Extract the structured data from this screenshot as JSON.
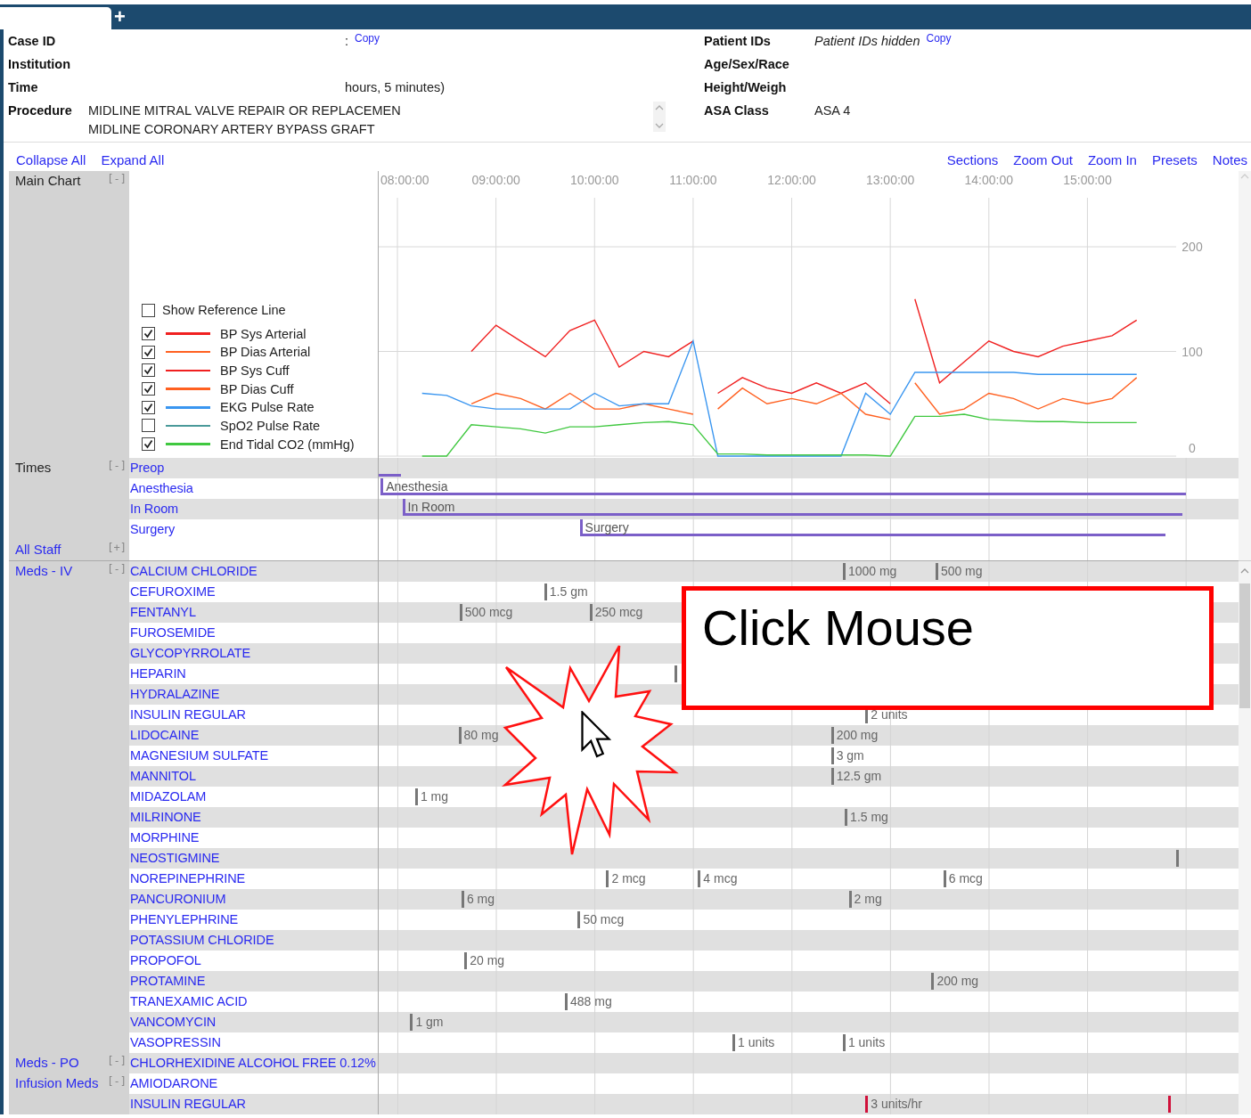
{
  "window": {
    "new_tab_button": "+"
  },
  "header": {
    "left": [
      {
        "label": "Case ID",
        "masked": true,
        "value": ":",
        "copy": "Copy"
      },
      {
        "label": "Institution"
      },
      {
        "label": "Time",
        "masked": true,
        "value": "hours, 5 minutes)"
      },
      {
        "label": "Procedure",
        "lines": [
          "MIDLINE MITRAL VALVE REPAIR OR REPLACEMEN",
          "MIDLINE CORONARY ARTERY BYPASS GRAFT"
        ]
      }
    ],
    "right": [
      {
        "label": "Patient IDs",
        "hidden": true,
        "value": "Patient IDs hidden",
        "copy": "Copy"
      },
      {
        "label": "Age/Sex/Race"
      },
      {
        "label": "Height/Weigh"
      },
      {
        "label": "ASA Class",
        "value": "ASA 4"
      }
    ]
  },
  "toolbar": {
    "left": [
      "Collapse All",
      "Expand All"
    ],
    "right": [
      "Sections",
      "Zoom Out",
      "Zoom In",
      "Presets",
      "Notes"
    ]
  },
  "sections": [
    {
      "kind": "chart",
      "name": "Main Chart",
      "toggle": "[-]",
      "reference_line": {
        "label": "Show Reference Line",
        "checked": false
      },
      "legend": [
        {
          "checked": true
        },
        {
          "checked": true
        },
        {
          "checked": true
        },
        {
          "checked": true
        },
        {
          "checked": true
        },
        {
          "checked": false
        },
        {
          "checked": true
        }
      ],
      "chart_data": {
        "type": "line",
        "grid": true,
        "x": [
          8.25,
          8.5,
          8.75,
          9,
          9.25,
          9.5,
          9.75,
          10,
          10.25,
          10.5,
          10.75,
          11,
          11.25,
          11.5,
          11.75,
          12,
          12.25,
          12.5,
          12.75,
          13,
          13.25,
          13.5,
          13.75,
          14,
          14.25,
          14.5,
          14.75,
          15,
          15.25,
          15.5
        ],
        "series": [
          {
            "name": "BP Sys Arterial",
            "color": "#f02020",
            "values": [
              null,
              null,
              100,
              125,
              110,
              95,
              120,
              130,
              85,
              100,
              95,
              110,
              null,
              null,
              null,
              null,
              null,
              null,
              null,
              null,
              150,
              70,
              90,
              110,
              100,
              95,
              105,
              110,
              115,
              130
            ]
          },
          {
            "name": "BP Dias Arterial",
            "color": "#ff6020",
            "values": [
              null,
              null,
              50,
              60,
              55,
              45,
              60,
              45,
              45,
              50,
              45,
              40,
              null,
              null,
              null,
              null,
              null,
              null,
              null,
              null,
              70,
              40,
              45,
              60,
              55,
              45,
              55,
              50,
              55,
              75
            ]
          },
          {
            "name": "BP Sys Cuff",
            "color": "#f02020",
            "values": [
              null,
              null,
              null,
              null,
              null,
              null,
              null,
              null,
              null,
              null,
              null,
              null,
              60,
              75,
              65,
              60,
              70,
              60,
              70,
              50,
              null,
              null,
              null,
              null,
              null,
              null,
              null,
              null,
              null,
              null
            ]
          },
          {
            "name": "BP Dias Cuff",
            "color": "#ff6020",
            "values": [
              null,
              null,
              null,
              null,
              null,
              null,
              null,
              null,
              null,
              null,
              null,
              null,
              45,
              65,
              50,
              55,
              50,
              60,
              40,
              35,
              null,
              null,
              null,
              null,
              null,
              null,
              null,
              null,
              null,
              null
            ]
          },
          {
            "name": "EKG Pulse Rate",
            "color": "#3a96f0",
            "values": [
              60,
              58,
              48,
              45,
              45,
              45,
              45,
              60,
              48,
              50,
              50,
              110,
              0,
              0,
              0,
              0,
              0,
              0,
              60,
              40,
              80,
              80,
              80,
              80,
              80,
              78,
              78,
              78,
              78,
              78
            ]
          },
          {
            "name": "SpO2 Pulse Rate",
            "color": "#4a9a9a",
            "values": [
              null,
              null,
              null,
              null,
              null,
              null,
              null,
              null,
              null,
              null,
              null,
              null,
              null,
              null,
              null,
              null,
              null,
              null,
              null,
              null,
              null,
              null,
              null,
              null,
              null,
              null,
              null,
              null,
              null,
              null
            ]
          },
          {
            "name": "End Tidal CO2 (mmHg)",
            "color": "#40c840",
            "values": [
              0,
              0,
              30,
              28,
              26,
              22,
              28,
              28,
              30,
              32,
              33,
              30,
              2,
              2,
              1,
              1,
              1,
              1,
              1,
              0,
              38,
              38,
              40,
              35,
              34,
              33,
              33,
              32,
              32,
              32
            ]
          }
        ],
        "xticks": [
          {
            "value": 8,
            "label": "08:00:00"
          },
          {
            "value": 9,
            "label": "09:00:00"
          },
          {
            "value": 10,
            "label": "10:00:00"
          },
          {
            "value": 11,
            "label": "11:00:00"
          },
          {
            "value": 12,
            "label": "12:00:00"
          },
          {
            "value": 13,
            "label": "13:00:00"
          },
          {
            "value": 14,
            "label": "14:00:00"
          },
          {
            "value": 15,
            "label": "15:00:00"
          }
        ],
        "yticks": [
          0,
          100,
          200
        ],
        "xlim": [
          7.81,
          15.9
        ],
        "ylim": [
          0,
          200
        ]
      }
    },
    {
      "kind": "times",
      "name": "Times",
      "toggle": "[-]",
      "rows": [
        {
          "name": "Preop"
        },
        {
          "name": "Anesthesia",
          "bar_label": "Anesthesia"
        },
        {
          "name": "In Room",
          "bar_label": "In Room"
        },
        {
          "name": "Surgery",
          "bar_label": "Surgery"
        }
      ]
    },
    {
      "kind": "staff",
      "name": "All Staff",
      "toggle": "[+]"
    },
    {
      "kind": "meds",
      "name": "Meds - IV",
      "toggle": "[-]",
      "rows": [
        {
          "name": "CALCIUM CHLORIDE",
          "doses": [
            {
              "kind": "bolus",
              "text": "1000 mg"
            },
            {
              "kind": "bolus",
              "text": "500 mg"
            }
          ]
        },
        {
          "name": "CEFUROXIME",
          "doses": [
            {
              "kind": "bolus",
              "text": "1.5 gm"
            }
          ]
        },
        {
          "name": "FENTANYL",
          "doses": [
            {
              "kind": "bolus",
              "text": "500 mcg"
            },
            {
              "kind": "bolus",
              "text": "250 mcg"
            }
          ]
        },
        {
          "name": "FUROSEMIDE"
        },
        {
          "name": "GLYCOPYRROLATE"
        },
        {
          "name": "HEPARIN",
          "doses": [
            {
              "kind": "bolus"
            }
          ]
        },
        {
          "name": "HYDRALAZINE"
        },
        {
          "name": "INSULIN REGULAR",
          "doses": [
            {
              "kind": "bolus",
              "text": "2 units"
            }
          ]
        },
        {
          "name": "LIDOCAINE",
          "doses": [
            {
              "kind": "bolus",
              "text": "80 mg"
            },
            {
              "kind": "bolus",
              "text": "200 mg"
            }
          ]
        },
        {
          "name": "MAGNESIUM SULFATE",
          "doses": [
            {
              "kind": "bolus",
              "text": "3 gm"
            }
          ]
        },
        {
          "name": "MANNITOL",
          "doses": [
            {
              "kind": "bolus",
              "text": "12.5 gm"
            }
          ]
        },
        {
          "name": "MIDAZOLAM",
          "doses": [
            {
              "kind": "bolus",
              "text": "1 mg"
            }
          ]
        },
        {
          "name": "MILRINONE",
          "doses": [
            {
              "kind": "bolus",
              "text": "1.5 mg"
            }
          ]
        },
        {
          "name": "MORPHINE"
        },
        {
          "name": "NEOSTIGMINE",
          "doses": [
            {
              "kind": "bolus"
            }
          ]
        },
        {
          "name": "NOREPINEPHRINE",
          "doses": [
            {
              "kind": "bolus",
              "text": "2 mcg"
            },
            {
              "kind": "bolus",
              "text": "4 mcg"
            },
            {
              "kind": "bolus",
              "text": "6 mcg"
            }
          ]
        },
        {
          "name": "PANCURONIUM",
          "doses": [
            {
              "kind": "bolus",
              "text": "6 mg"
            },
            {
              "kind": "bolus",
              "text": "2 mg"
            }
          ]
        },
        {
          "name": "PHENYLEPHRINE",
          "doses": [
            {
              "kind": "bolus",
              "text": "50 mcg"
            }
          ]
        },
        {
          "name": "POTASSIUM CHLORIDE"
        },
        {
          "name": "PROPOFOL",
          "doses": [
            {
              "kind": "bolus",
              "text": "20 mg"
            }
          ]
        },
        {
          "name": "PROTAMINE",
          "doses": [
            {
              "kind": "bolus",
              "text": "200 mg"
            }
          ]
        },
        {
          "name": "TRANEXAMIC ACID",
          "doses": [
            {
              "kind": "bolus",
              "text": "488 mg"
            }
          ]
        },
        {
          "name": "VANCOMYCIN",
          "doses": [
            {
              "kind": "bolus",
              "text": "1 gm"
            }
          ]
        },
        {
          "name": "VASOPRESSIN",
          "doses": [
            {
              "kind": "bolus",
              "text": "1 units"
            },
            {
              "kind": "bolus",
              "text": "1 units"
            }
          ]
        }
      ]
    },
    {
      "kind": "meds",
      "name": "Meds - PO",
      "toggle": "[-]",
      "rows": [
        {
          "name": "CHLORHEXIDINE ALCOHOL FREE 0.12%"
        }
      ]
    },
    {
      "kind": "meds",
      "name": "Infusion Meds",
      "toggle": "[-]",
      "rows": [
        {
          "name": "AMIODARONE"
        },
        {
          "name": "INSULIN REGULAR",
          "doses": [
            {
              "kind": "infusion",
              "text": "3 units/hr"
            },
            {
              "kind": "infusion"
            }
          ]
        }
      ]
    }
  ],
  "callout": {
    "text": "Click Mouse"
  }
}
